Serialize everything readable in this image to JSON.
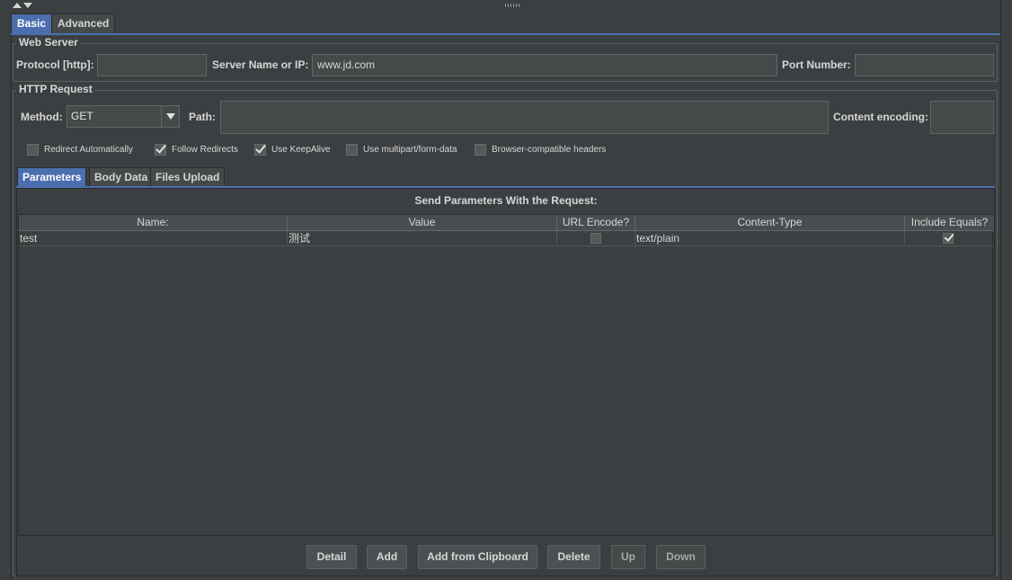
{
  "tabs": [
    "Basic",
    "Advanced"
  ],
  "web_server": {
    "legend": "Web Server",
    "protocol_label": "Protocol [http]:",
    "protocol_value": "",
    "server_label": "Server Name or IP:",
    "server_value": "www.jd.com",
    "port_label": "Port Number:",
    "port_value": ""
  },
  "http_request": {
    "legend": "HTTP Request",
    "method_label": "Method:",
    "method_value": "GET",
    "path_label": "Path:",
    "path_value": "",
    "encoding_label": "Content encoding:",
    "encoding_value": ""
  },
  "options": [
    {
      "label": "Redirect Automatically",
      "checked": false
    },
    {
      "label": "Follow Redirects",
      "checked": true
    },
    {
      "label": "Use KeepAlive",
      "checked": true
    },
    {
      "label": "Use multipart/form-data",
      "checked": false
    },
    {
      "label": "Browser-compatible headers",
      "checked": false
    }
  ],
  "inner_tabs": [
    "Parameters",
    "Body Data",
    "Files Upload"
  ],
  "params": {
    "title": "Send Parameters With the Request:",
    "columns": [
      "Name:",
      "Value",
      "URL Encode?",
      "Content-Type",
      "Include Equals?"
    ],
    "rows": [
      {
        "name": "test",
        "value": "测试",
        "url_encode": false,
        "content_type": "text/plain",
        "include_equals": true
      }
    ]
  },
  "buttons": [
    "Detail",
    "Add",
    "Add from Clipboard",
    "Delete",
    "Up",
    "Down"
  ]
}
